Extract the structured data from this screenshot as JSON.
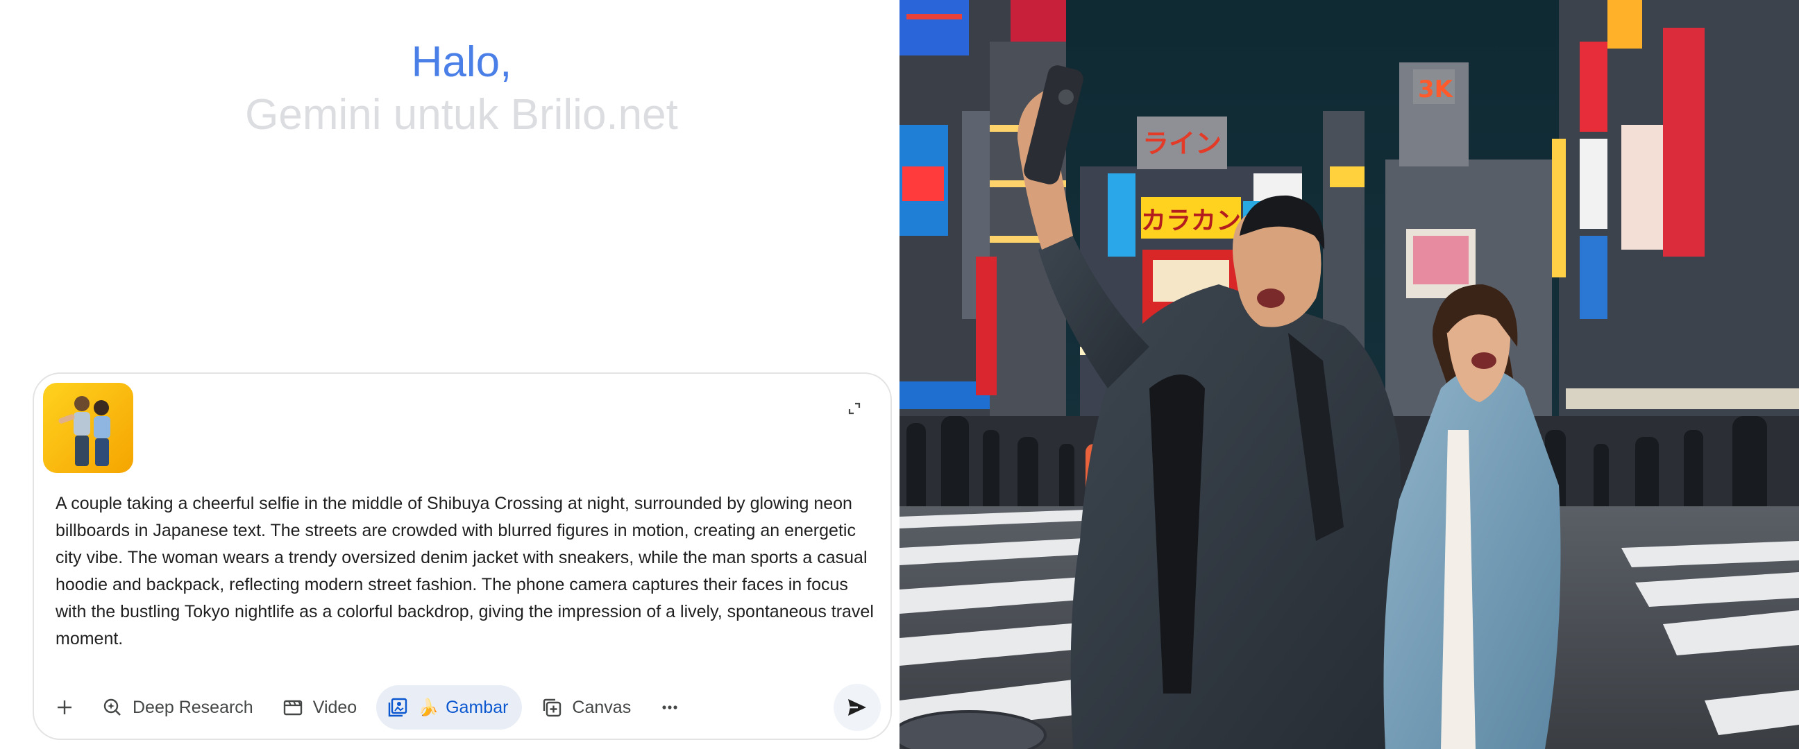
{
  "greeting": {
    "hello": "Halo,",
    "subtitle": "Gemini untuk Brilio.net"
  },
  "composer": {
    "attachment_alt": "Couple selfie reference image",
    "expand_icon": "expand-icon",
    "prompt": "A couple taking a cheerful selfie in the middle of Shibuya Crossing at night, surrounded by glowing neon billboards in Japanese text. The streets are crowded with blurred figures in motion, creating an energetic city vibe. The woman wears a trendy oversized denim jacket with sneakers, while the man sports a casual hoodie and backpack, reflecting modern street fashion. The phone camera captures their faces in focus with the bustling Tokyo nightlife as a colorful backdrop, giving the impression of a lively, spontaneous travel moment."
  },
  "toolbar": {
    "add_icon": "plus-icon",
    "tools": [
      {
        "label": "Deep Research",
        "icon": "deep-research-icon"
      },
      {
        "label": "Video",
        "icon": "video-icon"
      },
      {
        "label": "Gambar",
        "icon": "image-icon",
        "badge": "🍌",
        "active": true
      },
      {
        "label": "Canvas",
        "icon": "canvas-icon"
      }
    ],
    "more_icon": "more-icon",
    "send_icon": "send-icon"
  },
  "generated_image": {
    "neon_signs": [
      "ライン",
      "カラカン",
      "3K"
    ]
  },
  "colors": {
    "accent": "#4a7fe8",
    "active_chip_bg": "#e9eef6",
    "active_chip_text": "#0b57d0",
    "subtitle_gray": "#dcdde0"
  }
}
